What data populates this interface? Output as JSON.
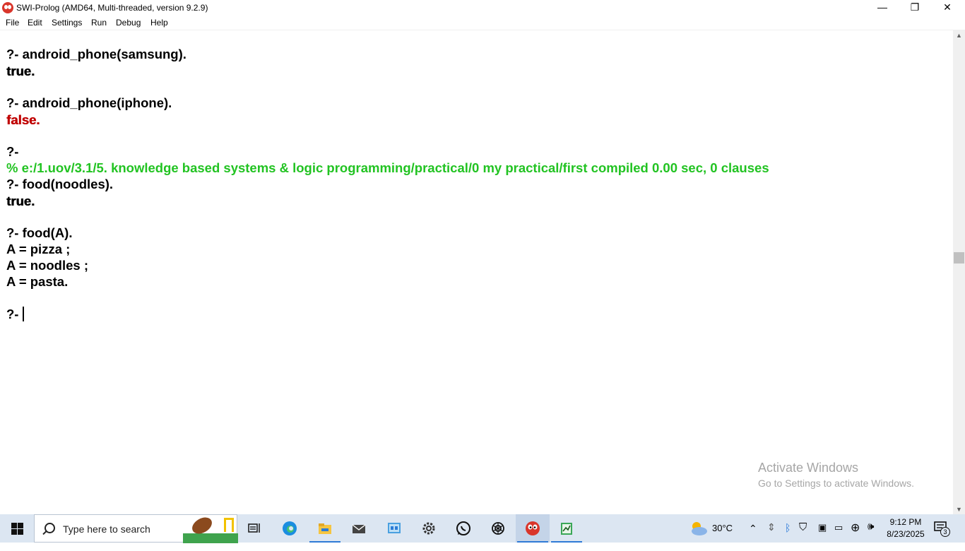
{
  "window": {
    "title": "SWI-Prolog (AMD64, Multi-threaded, version 9.2.9)",
    "minimize_glyph": "—",
    "restore_glyph": "❐",
    "close_glyph": "✕"
  },
  "menu": {
    "items": [
      "File",
      "Edit",
      "Settings",
      "Run",
      "Debug",
      "Help"
    ]
  },
  "console": {
    "lines": [
      "?- android_phone(samsung).",
      "true.",
      "?- android_phone(iphone).",
      "false.",
      "?-",
      "% e:/1.uov/3.1/5. knowledge based systems & logic programming/practical/0 my practical/first compiled 0.00 sec, 0 clauses",
      "?- food(noodles).",
      "true.",
      "?- food(A).",
      "A = pizza ;",
      "A = noodles ;",
      "A = pasta.",
      "?- "
    ],
    "colors": {
      "query": "#000000",
      "false": "#c00000",
      "message": "#22c322"
    }
  },
  "watermark": {
    "title": "Activate Windows",
    "subtitle": "Go to Settings to activate Windows."
  },
  "taskbar": {
    "search_placeholder": "Type here to search",
    "icons": [
      "windows-start-icon",
      "task-view-icon",
      "edge-icon",
      "file-explorer-icon",
      "mail-icon",
      "control-panel-icon",
      "settings-gear-icon",
      "whatsapp-icon",
      "chatgpt-icon",
      "swi-prolog-icon",
      "notepad-icon"
    ],
    "weather_temp": "30°C",
    "time": "9:12 PM",
    "date": "8/23/2025",
    "notification_count": "3"
  }
}
